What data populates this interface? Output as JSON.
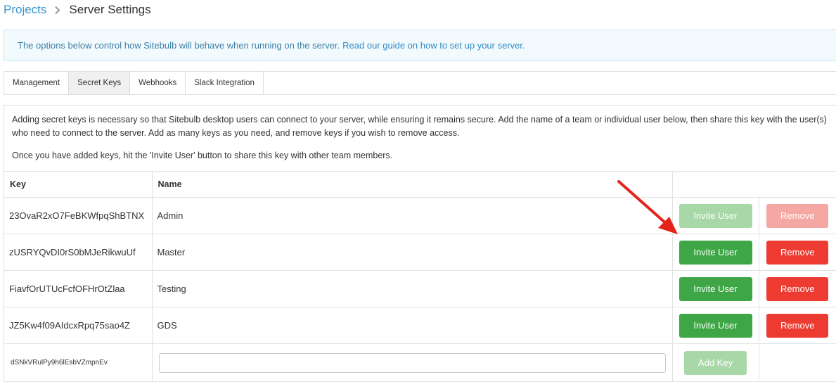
{
  "breadcrumb": {
    "parent": "Projects",
    "current": "Server Settings"
  },
  "info": {
    "text": "The options below control how Sitebulb will behave when running on the server.",
    "link": "Read our guide on how to set up your server."
  },
  "tabs": [
    {
      "label": "Management",
      "active": false
    },
    {
      "label": "Secret Keys",
      "active": true
    },
    {
      "label": "Webhooks",
      "active": false
    },
    {
      "label": "Slack Integration",
      "active": false
    }
  ],
  "description": {
    "para1": "Adding secret keys is necessary so that Sitebulb desktop users can connect to your server, while ensuring it remains secure. Add the name of a team or individual user below, then share this key with the user(s) who need to connect to the server. Add as many keys as you need, and remove keys if you wish to remove access.",
    "para2": "Once you have added keys, hit the 'Invite User' button to share this key with other team members."
  },
  "table": {
    "headers": {
      "key": "Key",
      "name": "Name"
    },
    "rows": [
      {
        "key": "23OvaR2xO7FeBKWfpqShBTNX",
        "name": "Admin",
        "invite": "Invite User",
        "remove": "Remove",
        "disabled": true
      },
      {
        "key": "zUSRYQvDI0rS0bMJeRikwuUf",
        "name": "Master",
        "invite": "Invite User",
        "remove": "Remove",
        "disabled": false
      },
      {
        "key": "FiavfOrUTUcFcfOFHrOtZlaa",
        "name": "Testing",
        "invite": "Invite User",
        "remove": "Remove",
        "disabled": false
      },
      {
        "key": "JZ5Kw4f09AIdcxRpq75sao4Z",
        "name": "GDS",
        "invite": "Invite User",
        "remove": "Remove",
        "disabled": false
      }
    ],
    "new_key": "dSNkVRulPy9h6lEsbVZmpnEv",
    "name_input_value": "",
    "add_label": "Add Key"
  },
  "colors": {
    "accent_link": "#3a95c9",
    "invite_green": "#3ea646",
    "remove_red": "#ee3b32",
    "annotation_arrow": "#e3241b"
  },
  "icons": {
    "breadcrumb_separator": "chevron-right-icon",
    "annotation": "red-arrow-icon"
  }
}
